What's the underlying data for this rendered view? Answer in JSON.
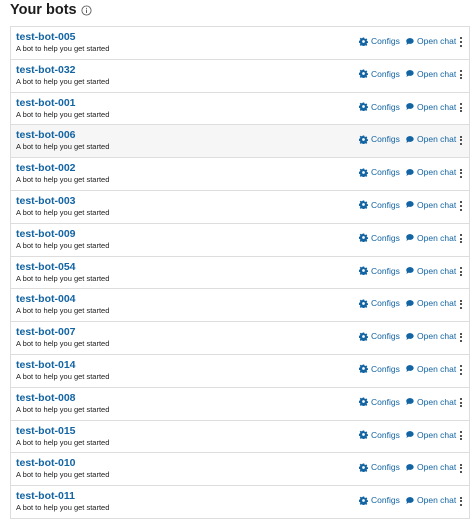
{
  "header": {
    "title": "Your bots",
    "info_icon": "info-circle-icon"
  },
  "colors": {
    "link": "#1264a3",
    "text": "#1d1c1d",
    "border": "#dddddd",
    "hover_row": "#f6f6f6"
  },
  "actions": {
    "configs_label": "Configs",
    "configs_icon": "gear-icon",
    "chat_label": "Open chat",
    "chat_icon": "chat-bubble-icon",
    "more_icon": "kebab-menu-icon"
  },
  "bots": [
    {
      "name": "test-bot-005",
      "description": "A bot to help you get started"
    },
    {
      "name": "test-bot-032",
      "description": "A bot to help you get started"
    },
    {
      "name": "test-bot-001",
      "description": "A bot to help you get started"
    },
    {
      "name": "test-bot-006",
      "description": "A bot to help you get started"
    },
    {
      "name": "test-bot-002",
      "description": "A bot to help you get started"
    },
    {
      "name": "test-bot-003",
      "description": "A bot to help you get started"
    },
    {
      "name": "test-bot-009",
      "description": "A bot to help you get started"
    },
    {
      "name": "test-bot-054",
      "description": "A bot to help you get started"
    },
    {
      "name": "test-bot-004",
      "description": "A bot to help you get started"
    },
    {
      "name": "test-bot-007",
      "description": "A bot to help you get started"
    },
    {
      "name": "test-bot-014",
      "description": "A bot to help you get started"
    },
    {
      "name": "test-bot-008",
      "description": "A bot to help you get started"
    },
    {
      "name": "test-bot-015",
      "description": "A bot to help you get started"
    },
    {
      "name": "test-bot-010",
      "description": "A bot to help you get started"
    },
    {
      "name": "test-bot-011",
      "description": "A bot to help you get started"
    }
  ]
}
